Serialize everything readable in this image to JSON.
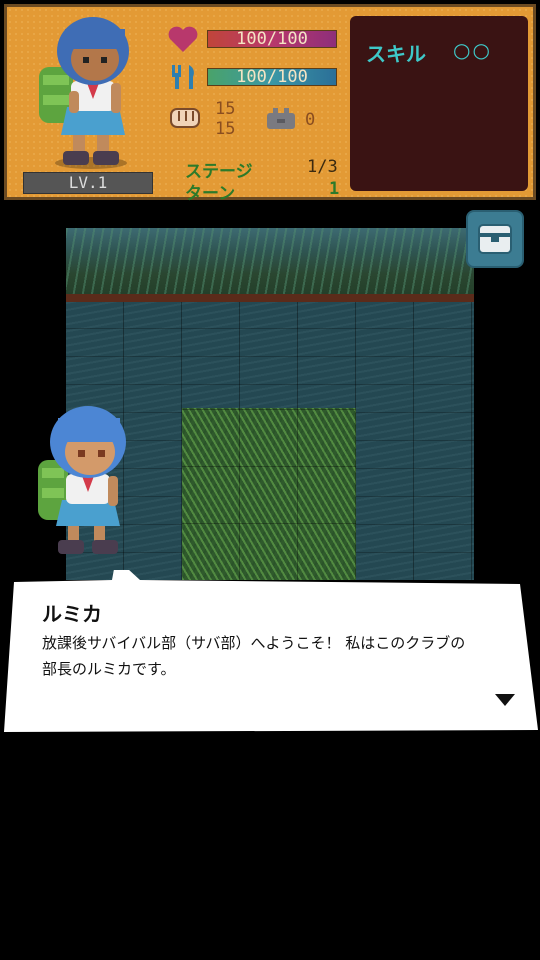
{
  "player": {
    "level": "LV.1",
    "hp": "100/100",
    "hunger": "100/100",
    "attack": "15",
    "defense": "15",
    "item_count": "0"
  },
  "stage": {
    "label": "ステージ",
    "value": "1/3"
  },
  "turn": {
    "label": "ターン",
    "value": "1"
  },
  "skill": {
    "label": "スキル",
    "value": "○○"
  },
  "dialog": {
    "speaker": "ルミカ",
    "line1": "放課後サバイバル部（サバ部）へようこそ！ 私はこのクラブの",
    "line2": "部長のルミカです。"
  },
  "icons": {
    "hp": "heart-icon",
    "hunger": "fork-knife-icon",
    "attack": "fist-icon",
    "item": "bag-icon",
    "inventory": "chest-icon",
    "advance": "triangle-down-icon"
  },
  "colors": {
    "panel": "#e39a35",
    "hp_bar": "#b8386c",
    "food_bar": "#3b97a5",
    "skill_text": "#3ec9c9",
    "stage_text": "#2c7a2a"
  }
}
